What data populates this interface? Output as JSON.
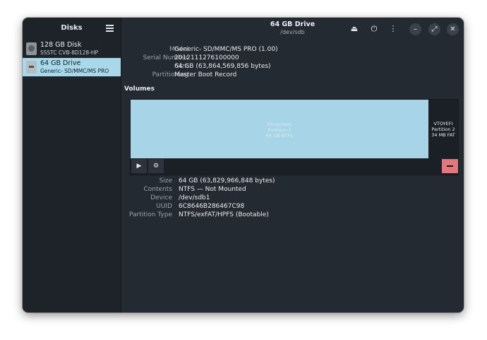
{
  "sidebar": {
    "title": "Disks",
    "menu_icon": "hamburger-menu-icon",
    "disks": [
      {
        "name": "128 GB Disk",
        "subtitle": "SSSTC CVB-8D128-HP",
        "icon": "hard-disk-icon",
        "selected": false
      },
      {
        "name": "64 GB Drive",
        "subtitle": "Generic- SD/MMC/MS PRO",
        "icon": "removable-drive-icon",
        "selected": true
      }
    ]
  },
  "header": {
    "title": "64 GB Drive",
    "subtitle": "/dev/sdb",
    "buttons": [
      {
        "name": "eject-button",
        "icon": "eject-icon",
        "glyph": "⏏"
      },
      {
        "name": "power-off-button",
        "icon": "power-icon",
        "glyph": "⏻"
      },
      {
        "name": "drive-menu-button",
        "icon": "vertical-ellipsis-icon",
        "glyph": "⋮"
      },
      {
        "name": "minimize-button",
        "icon": "minimize-icon",
        "glyph": "–"
      },
      {
        "name": "maximize-button",
        "icon": "maximize-icon",
        "glyph": "⤢"
      },
      {
        "name": "close-button",
        "icon": "close-icon",
        "glyph": "✕"
      }
    ]
  },
  "drive_info": {
    "model_label": "Model",
    "model": "Generic- SD/MMC/MS PRO (1.00)",
    "serial_label": "Serial Number",
    "serial": "2012111276100000",
    "size_label": "Size",
    "size": "64 GB (63,864,569,856 bytes)",
    "partitioning_label": "Partitioning",
    "partitioning": "Master Boot Record"
  },
  "volumes": {
    "heading": "Volumes",
    "partitions": [
      {
        "line1": "Filesystem",
        "line2": "Partition 1",
        "line3": "64 GB NTFS",
        "selected": true,
        "fraction_of_bar": 0.909
      },
      {
        "line1": "VTOYEFI",
        "line2": "Partition 2",
        "line3": "34 MB FAT",
        "selected": false,
        "fraction_of_bar": 0.091
      }
    ],
    "toolbar": [
      {
        "name": "mount-button",
        "icon": "play-icon",
        "glyph": "▶"
      },
      {
        "name": "partition-settings-button",
        "icon": "gears-icon",
        "glyph": "⚙"
      },
      {
        "name": "delete-partition-button",
        "icon": "minus-icon",
        "color": "#e0787d"
      }
    ]
  },
  "volume_info": {
    "size_label": "Size",
    "size": "64 GB (63,829,966,848 bytes)",
    "contents_label": "Contents",
    "contents": "NTFS — Not Mounted",
    "device_label": "Device",
    "device": "/dev/sdb1",
    "uuid_label": "UUID",
    "uuid": "6C8646B286467C98",
    "partition_type_label": "Partition Type",
    "partition_type": "NTFS/exFAT/HPFS (Bootable)"
  },
  "colors": {
    "window_bg": "#242a31",
    "sidebar_bg": "#1e2329",
    "selection": "#a8d8ea",
    "partition_selected": "#a8d4e7",
    "destructive": "#e0787d"
  }
}
